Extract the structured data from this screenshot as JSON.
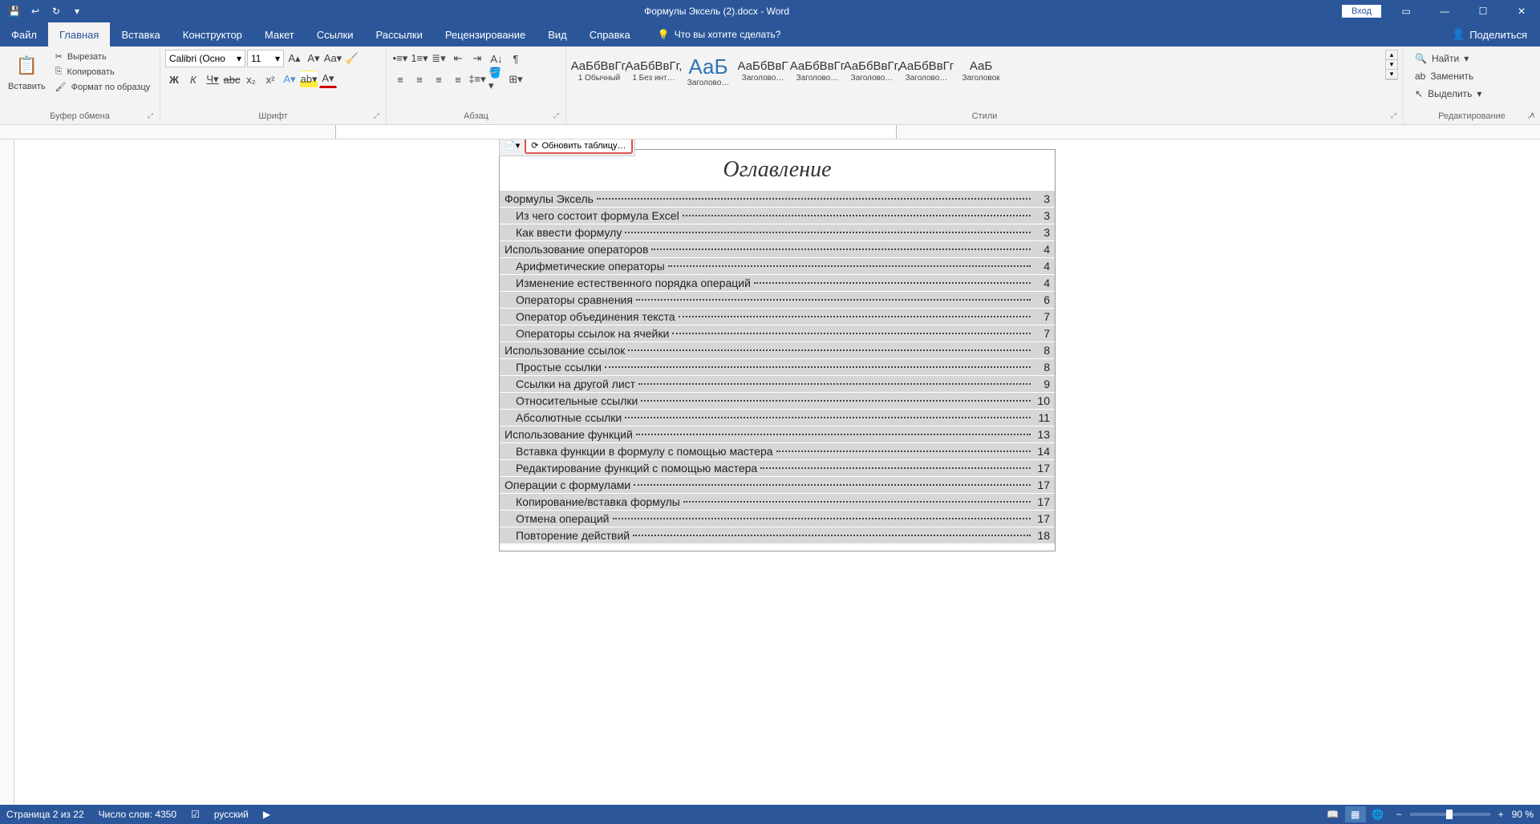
{
  "title": "Формулы Эксель (2).docx  -  Word",
  "login": "Вход",
  "tabs": [
    "Файл",
    "Главная",
    "Вставка",
    "Конструктор",
    "Макет",
    "Ссылки",
    "Рассылки",
    "Рецензирование",
    "Вид",
    "Справка"
  ],
  "active_tab": 1,
  "tell_me": "Что вы хотите сделать?",
  "share": "Поделиться",
  "clipboard": {
    "paste": "Вставить",
    "cut": "Вырезать",
    "copy": "Копировать",
    "format": "Формат по образцу",
    "label": "Буфер обмена"
  },
  "font": {
    "name": "Calibri (Осно",
    "size": "11",
    "label": "Шрифт"
  },
  "paragraph": {
    "label": "Абзац"
  },
  "styles_label": "Стили",
  "styles": [
    {
      "preview": "АаБбВвГг,",
      "name": "1 Обычный"
    },
    {
      "preview": "АаБбВвГг,",
      "name": "1 Без инт…"
    },
    {
      "preview": "АаБ",
      "name": "Заголово…",
      "big": true
    },
    {
      "preview": "АаБбВвГ",
      "name": "Заголово…"
    },
    {
      "preview": "АаБбВвГг",
      "name": "Заголово…"
    },
    {
      "preview": "АаБбВвГг,",
      "name": "Заголово…"
    },
    {
      "preview": "АаБбВвГг",
      "name": "Заголово…"
    },
    {
      "preview": "АаБ",
      "name": "Заголовок"
    }
  ],
  "editing": {
    "find": "Найти",
    "replace": "Заменить",
    "select": "Выделить",
    "label": "Редактирование"
  },
  "toc_bar_update": "Обновить таблицу…",
  "toc_title": "Оглавление",
  "toc": [
    {
      "level": 1,
      "text": "Формулы Эксель",
      "page": "3"
    },
    {
      "level": 2,
      "text": "Из чего состоит формула Excel",
      "page": "3"
    },
    {
      "level": 2,
      "text": "Как ввести формулу",
      "page": "3"
    },
    {
      "level": 1,
      "text": "Использование операторов",
      "page": "4"
    },
    {
      "level": 2,
      "text": "Арифметические операторы",
      "page": "4"
    },
    {
      "level": 2,
      "text": "Изменение естественного порядка операций",
      "page": "4"
    },
    {
      "level": 2,
      "text": "Операторы сравнения",
      "page": "6"
    },
    {
      "level": 2,
      "text": "Оператор объединения текста",
      "page": "7"
    },
    {
      "level": 2,
      "text": "Операторы ссылок на ячейки",
      "page": "7"
    },
    {
      "level": 1,
      "text": "Использование ссылок",
      "page": "8"
    },
    {
      "level": 2,
      "text": "Простые ссылки",
      "page": "8"
    },
    {
      "level": 2,
      "text": "Ссылки на другой лист",
      "page": "9"
    },
    {
      "level": 2,
      "text": "Относительные ссылки",
      "page": "10"
    },
    {
      "level": 2,
      "text": "Абсолютные ссылки",
      "page": "11"
    },
    {
      "level": 1,
      "text": "Использование функций",
      "page": "13"
    },
    {
      "level": 2,
      "text": "Вставка функции в формулу с помощью мастера",
      "page": "14"
    },
    {
      "level": 2,
      "text": "Редактирование функций с помощью мастера",
      "page": "17"
    },
    {
      "level": 1,
      "text": "Операции с формулами",
      "page": "17"
    },
    {
      "level": 2,
      "text": "Копирование/вставка формулы",
      "page": "17"
    },
    {
      "level": 2,
      "text": "Отмена операций",
      "page": "17"
    },
    {
      "level": 2,
      "text": "Повторение действий",
      "page": "18"
    }
  ],
  "status": {
    "page": "Страница 2 из 22",
    "words": "Число слов: 4350",
    "lang": "русский",
    "zoom": "90 %"
  }
}
